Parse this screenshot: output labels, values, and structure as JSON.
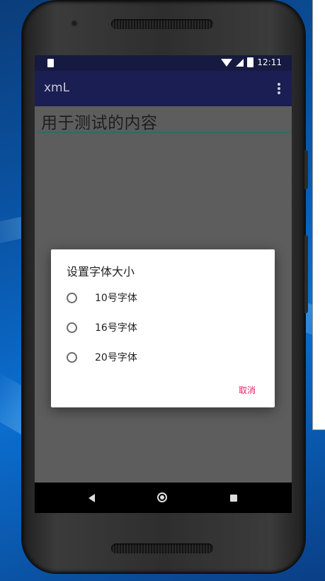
{
  "statusbar": {
    "time": "12:11",
    "icons": [
      "sd-card-icon",
      "wifi-icon",
      "cell-signal-icon",
      "battery-charging-icon"
    ]
  },
  "app": {
    "title": "xmL"
  },
  "content": {
    "edit_text": "用于测试的内容"
  },
  "dialog": {
    "title": "设置字体大小",
    "options": [
      {
        "label": "10号字体",
        "selected": false
      },
      {
        "label": "16号字体",
        "selected": false
      },
      {
        "label": "20号字体",
        "selected": false
      }
    ],
    "cancel_label": "取消"
  },
  "navbar": {
    "icons": [
      "back-icon",
      "home-icon",
      "recents-icon"
    ]
  },
  "colors": {
    "status_bar": "#161a40",
    "app_bar": "#1b1e52",
    "accent": "#e91e63",
    "scrim": "#5d5d5d"
  }
}
